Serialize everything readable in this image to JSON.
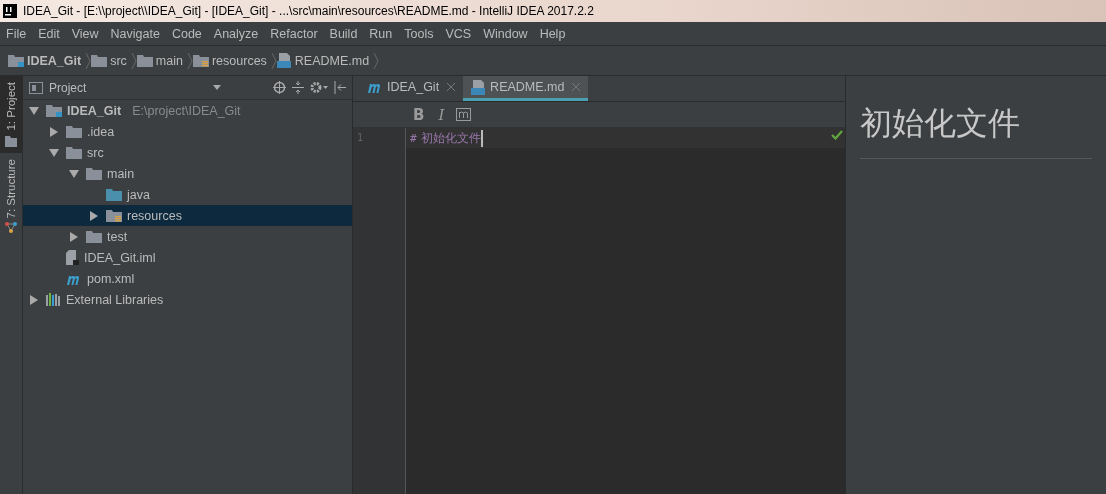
{
  "window": {
    "title": "IDEA_Git - [E:\\\\project\\\\IDEA_Git] - [IDEA_Git] - ...\\src\\main\\resources\\README.md - IntelliJ IDEA 2017.2.2"
  },
  "menu": [
    "File",
    "Edit",
    "View",
    "Navigate",
    "Code",
    "Analyze",
    "Refactor",
    "Build",
    "Run",
    "Tools",
    "VCS",
    "Window",
    "Help"
  ],
  "breadcrumb": [
    {
      "label": "IDEA_Git",
      "kind": "module"
    },
    {
      "label": "src",
      "kind": "folder"
    },
    {
      "label": "main",
      "kind": "folder"
    },
    {
      "label": "resources",
      "kind": "resources"
    },
    {
      "label": "README.md",
      "kind": "md"
    }
  ],
  "side_tabs": [
    {
      "label": "1: Project",
      "kind": "project",
      "selected": true
    },
    {
      "label": "7: Structure",
      "kind": "structure",
      "selected": false
    }
  ],
  "project_panel": {
    "title": "Project",
    "tree": [
      {
        "label": "IDEA_Git",
        "path": "E:\\project\\IDEA_Git",
        "kind": "module",
        "expanded": true,
        "selected": false,
        "children": [
          {
            "label": ".idea",
            "kind": "folder",
            "expanded": false,
            "selected": false
          },
          {
            "label": "src",
            "kind": "folder",
            "expanded": true,
            "selected": false,
            "children": [
              {
                "label": "main",
                "kind": "folder",
                "expanded": true,
                "selected": false,
                "children": [
                  {
                    "label": "java",
                    "kind": "source",
                    "selected": false
                  },
                  {
                    "label": "resources",
                    "kind": "resources",
                    "expanded": false,
                    "selected": true
                  }
                ]
              },
              {
                "label": "test",
                "kind": "folder",
                "expanded": false,
                "selected": false
              }
            ]
          },
          {
            "label": "IDEA_Git.iml",
            "kind": "iml",
            "selected": false
          },
          {
            "label": "pom.xml",
            "kind": "maven",
            "selected": false
          }
        ]
      },
      {
        "label": "External Libraries",
        "kind": "libraries",
        "expanded": false,
        "selected": false
      }
    ]
  },
  "editor_tabs": [
    {
      "label": "IDEA_Git",
      "kind": "maven",
      "selected": false
    },
    {
      "label": "README.md",
      "kind": "md",
      "selected": true
    }
  ],
  "format_toolbar": [
    {
      "label": "B",
      "kind": "bold"
    },
    {
      "label": "I",
      "kind": "italic"
    },
    {
      "kind": "code"
    }
  ],
  "editor": {
    "lines": [
      {
        "number": "1",
        "marker": "#",
        "text": "初始化文件"
      }
    ]
  },
  "preview": {
    "heading": "初始化文件"
  }
}
